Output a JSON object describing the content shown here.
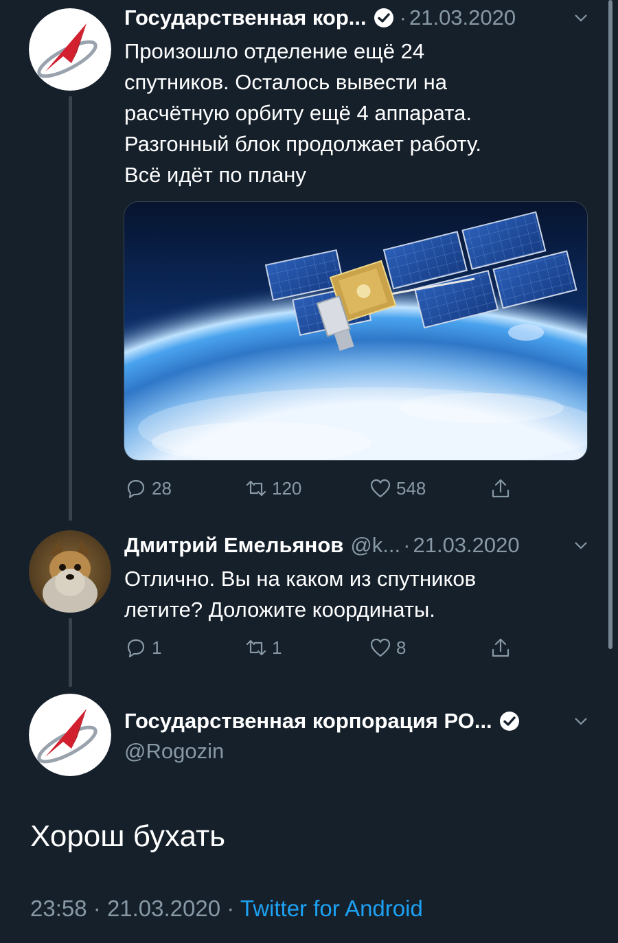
{
  "thread": [
    {
      "avatar_icon": "roscosmos-logo",
      "display_name": "Государственная кор...",
      "verified": true,
      "separator": "·",
      "date": "21.03.2020",
      "text_lines": [
        "Произошло отделение ещё 24",
        "спутников. Осталось вывести на",
        "расчётную орбиту ещё 4 аппарата.",
        "Разгонный блок продолжает работу.",
        "Всё идёт по плану"
      ],
      "media": "satellite-over-earth-image",
      "reply_count": "28",
      "retweet_count": "120",
      "like_count": "548"
    },
    {
      "avatar_icon": "yorkshire-terrier-photo",
      "display_name": "Дмитрий Емельянов",
      "handle": "@k...",
      "separator": "·",
      "date": "21.03.2020",
      "text_lines": [
        "Отлично. Вы на каком из спутников",
        "летите? Доложите координаты."
      ],
      "reply_count": "1",
      "retweet_count": "1",
      "like_count": "8"
    }
  ],
  "main_tweet": {
    "avatar_icon": "roscosmos-logo",
    "display_name": "Государственная корпорация РО...",
    "verified": true,
    "handle": "@Rogozin",
    "text": "Хорош бухать",
    "time": "23:58",
    "separator": "·",
    "date": "21.03.2020",
    "source": "Twitter for Android"
  },
  "colors": {
    "background": "#15202b",
    "secondary_text": "#8899a6",
    "link": "#1da1f2",
    "logo_red": "#d2202f"
  }
}
